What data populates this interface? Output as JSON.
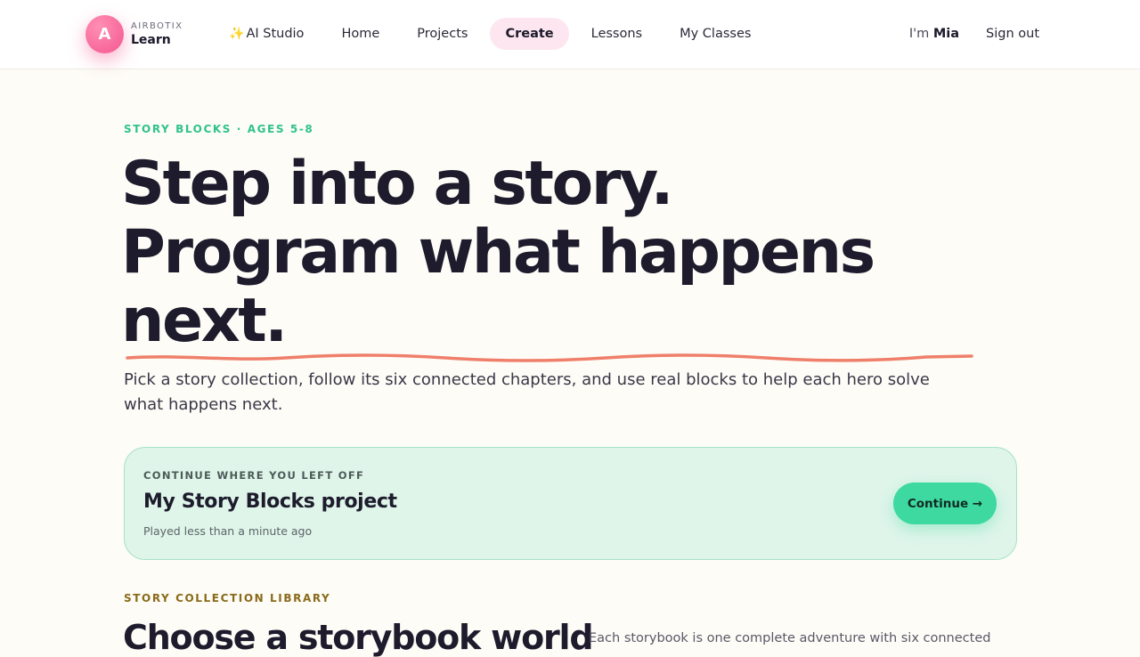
{
  "header": {
    "brand_small": "AIRBOTIX",
    "brand_big": "Learn",
    "logo_letter": "A",
    "nav": [
      {
        "label": "AI Studio",
        "icon": "sparkles-icon"
      },
      {
        "label": "Home"
      },
      {
        "label": "Projects"
      },
      {
        "label": "Create",
        "active": true
      },
      {
        "label": "Lessons"
      },
      {
        "label": "My Classes"
      }
    ],
    "greeting_prefix": "I'm",
    "user_name": "Mia",
    "signout_label": "Sign out"
  },
  "hero": {
    "eyebrow": "STORY BLOCKS · AGES 5-8",
    "title_line1": "Step into a story.",
    "title_line2": "Program what happens",
    "title_line3": "next.",
    "description": "Pick a story collection, follow its six connected chapters, and use real blocks to help each hero solve what happens next."
  },
  "continue_card": {
    "label": "CONTINUE WHERE YOU LEFT OFF",
    "title": "My Story Blocks project",
    "meta": "Played less than a minute ago",
    "button_label": "Continue →"
  },
  "library": {
    "eyebrow": "STORY COLLECTION LIBRARY",
    "title": "Choose a storybook world",
    "description": "Each storybook is one complete adventure with six connected"
  },
  "colors": {
    "accent_pink": "#f4568f",
    "accent_green": "#3dd9a0",
    "eyebrow_green": "#2fc38a",
    "squiggle": "#ef7f6a"
  }
}
